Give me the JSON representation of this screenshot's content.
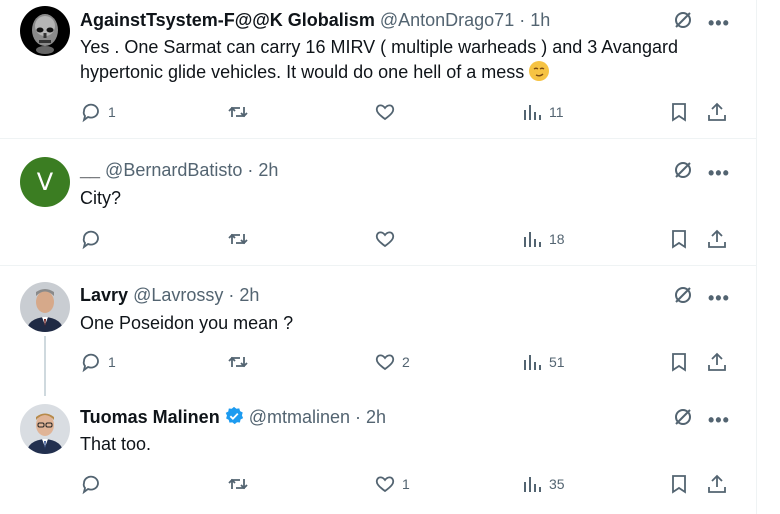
{
  "tweets": [
    {
      "name": "AgainstTsystem-F@@K Globalism",
      "handle": "@AntonDrago71",
      "time": "1h",
      "text": "Yes . One Sarmat can carry 16 MIRV ( multiple warheads ) and 3 Avangard hypertonic glide vehicles. It would do one hell of a mess",
      "replies": "1",
      "retweets": "",
      "likes": "",
      "views": "11",
      "avatar": "skull-mask-avatar"
    },
    {
      "name": "__",
      "handle": "@BernardBatisto",
      "time": "2h",
      "text": "City?",
      "replies": "",
      "retweets": "",
      "likes": "",
      "views": "18",
      "avatar_letter": "V"
    },
    {
      "name": "Lavry",
      "handle": "@Lavrossy",
      "time": "2h",
      "text": "One Poseidon you mean ?",
      "replies": "1",
      "retweets": "",
      "likes": "2",
      "views": "51",
      "avatar": "man-in-suit-avatar"
    },
    {
      "name": "Tuomas Malinen",
      "handle": "@mtmalinen",
      "time": "2h",
      "text": "That too.",
      "replies": "",
      "retweets": "",
      "likes": "1",
      "views": "35",
      "avatar": "man-glasses-avatar",
      "verified": true
    }
  ],
  "separator": "·",
  "more_glyph": "•••",
  "colors": {
    "text": "#0f1419",
    "secondary": "#536471",
    "divider": "#eff3f4",
    "verified": "#1d9bf0",
    "avatar_v_bg": "#3b7d22"
  }
}
